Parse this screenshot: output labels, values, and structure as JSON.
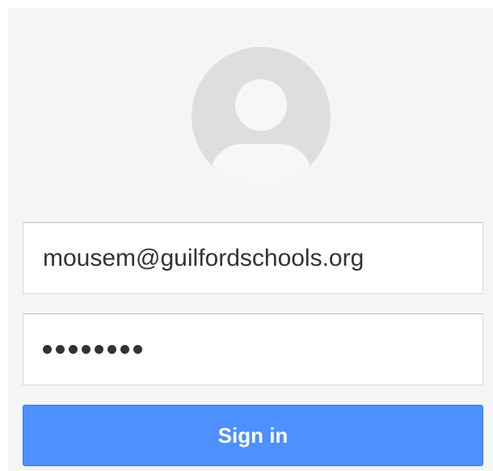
{
  "login": {
    "email_value": "mousem@guilfordschools.org",
    "password_mask": "●●●●●●●●",
    "password_length": 8,
    "signin_label": "Sign in"
  },
  "colors": {
    "card_background": "#f5f5f5",
    "avatar_circle": "#dedede",
    "avatar_figure": "#f7f7f7",
    "button_blue": "#4d90fe",
    "text": "#333333"
  },
  "icons": {
    "avatar": "default-profile-avatar-icon"
  }
}
